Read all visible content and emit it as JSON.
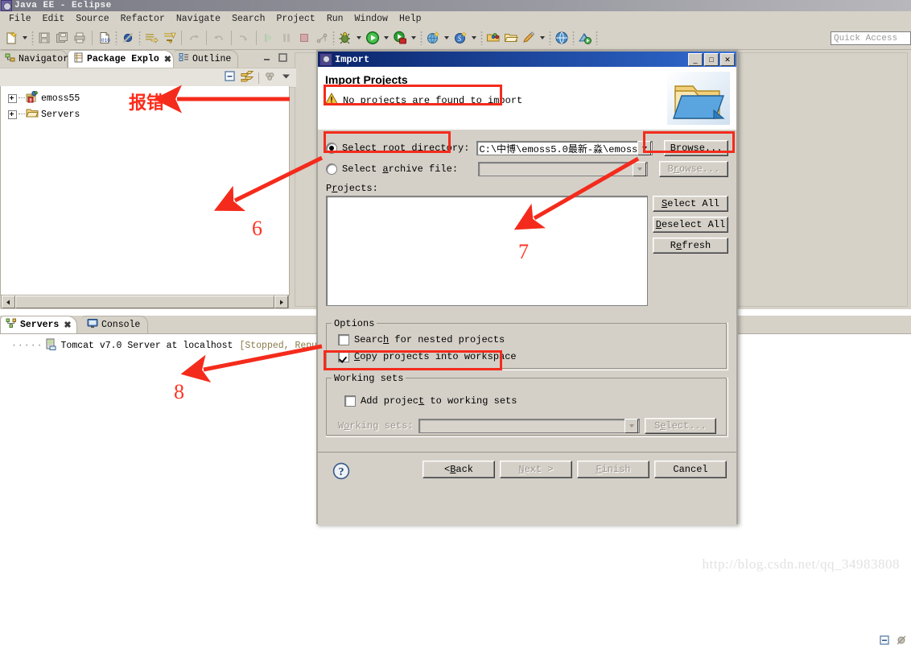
{
  "window": {
    "title": "Java EE - Eclipse",
    "icon": "eclipse-icon"
  },
  "menubar": {
    "items": [
      {
        "label": "File"
      },
      {
        "label": "Edit"
      },
      {
        "label": "Source"
      },
      {
        "label": "Refactor"
      },
      {
        "label": "Navigate"
      },
      {
        "label": "Search"
      },
      {
        "label": "Project"
      },
      {
        "label": "Run"
      },
      {
        "label": "Window"
      },
      {
        "label": "Help"
      }
    ]
  },
  "quick_access": {
    "placeholder": "Quick Access"
  },
  "left_view": {
    "tabs": [
      {
        "label": "Navigator",
        "icon": "navigator-icon",
        "selected": false,
        "closable": false
      },
      {
        "label": "Package Explo",
        "icon": "package-explorer-icon",
        "selected": true,
        "closable": true
      },
      {
        "label": "Outline",
        "icon": "outline-icon",
        "selected": false,
        "closable": false
      }
    ],
    "tree": [
      {
        "label": "emoss55",
        "icon": "java-project-error-icon"
      },
      {
        "label": "Servers",
        "icon": "folder-icon"
      }
    ],
    "toolbar_icons": [
      "collapse-all-icon",
      "link-with-editor-icon",
      "view-menu-icon",
      "view-dropdown-icon"
    ],
    "window_controls": [
      "minimize-icon",
      "maximize-icon"
    ]
  },
  "bottom_view": {
    "tabs": [
      {
        "label": "Servers",
        "icon": "servers-icon",
        "selected": true,
        "closable": true
      },
      {
        "label": "Console",
        "icon": "console-icon",
        "selected": false,
        "closable": false
      }
    ],
    "server": {
      "name": "Tomcat v7.0 Server at localhost",
      "status": "[Stopped, Republish]",
      "icon": "server-icon"
    },
    "window_controls": [
      "minimize-icon",
      "maximize-icon"
    ]
  },
  "dialog": {
    "title": "Import",
    "title_icon": "import-wizard-icon",
    "title_buttons": [
      {
        "name": "minimize",
        "glyph": "_"
      },
      {
        "name": "maximize",
        "glyph": "□"
      },
      {
        "name": "close",
        "glyph": "✕"
      }
    ],
    "heading": "Import Projects",
    "message": "No projects are found to import",
    "message_icon": "warning-icon",
    "banner_icon": "import-folder-icon",
    "source": {
      "root_directory": {
        "label": "Select roo",
        "label_underlined": "t",
        "label_rest": " directory:",
        "selected": true,
        "value": "C:\\中博\\emoss5.0最新-淼\\emoss",
        "browse_label_pre": "B",
        "browse_label_u": "r",
        "browse_label_post": "owse...",
        "browse_enabled": true
      },
      "archive_file": {
        "label": "Select ",
        "label_underlined": "a",
        "label_rest": "rchive file:",
        "selected": false,
        "value": "",
        "browse_label_pre": "B",
        "browse_label_u": "r",
        "browse_label_post": "owse...",
        "browse_enabled": false
      }
    },
    "projects": {
      "label_pre": "P",
      "label_u": "r",
      "label_post": "ojects:",
      "items": [],
      "buttons": [
        {
          "pre": "",
          "u": "S",
          "post": "elect All",
          "enabled": true
        },
        {
          "pre": "",
          "u": "D",
          "post": "eselect All",
          "enabled": true
        },
        {
          "pre": "R",
          "u": "e",
          "post": "fresh",
          "enabled": true
        }
      ]
    },
    "options": {
      "title": "Options",
      "checkboxes": [
        {
          "pre": "Searc",
          "u": "h",
          "post": " for nested projects",
          "checked": false
        },
        {
          "pre": "",
          "u": "C",
          "post": "opy projects into workspace",
          "checked": true
        }
      ]
    },
    "working_sets": {
      "title": "Working sets",
      "checkbox": {
        "pre": "Add projec",
        "u": "t",
        "post": " to working sets",
        "checked": false
      },
      "combo_label_pre": "W",
      "combo_label_u": "o",
      "combo_label_post": "rking sets:",
      "combo_value": "",
      "select_pre": "S",
      "select_u": "e",
      "select_post": "lect...",
      "enabled": false
    },
    "footer": {
      "help_icon": "help-icon",
      "buttons": [
        {
          "label": "< Back",
          "pre": "< ",
          "u": "B",
          "post": "ack",
          "enabled": true,
          "default": false
        },
        {
          "label": "Next >",
          "pre": "",
          "u": "N",
          "post": "ext >",
          "enabled": false,
          "default": false
        },
        {
          "label": "Finish",
          "pre": "",
          "u": "F",
          "post": "inish",
          "enabled": false,
          "default": false
        },
        {
          "label": "Cancel",
          "pre": "Cancel",
          "u": "",
          "post": "",
          "enabled": true,
          "default": false
        }
      ]
    }
  },
  "annotations": {
    "chinese_note": "报错",
    "numbers": [
      {
        "value": "6"
      },
      {
        "value": "7"
      },
      {
        "value": "8"
      }
    ],
    "accent_color": "#f42b1c"
  },
  "watermark": {
    "text": "http://blog.csdn.net/qq_34983808"
  }
}
